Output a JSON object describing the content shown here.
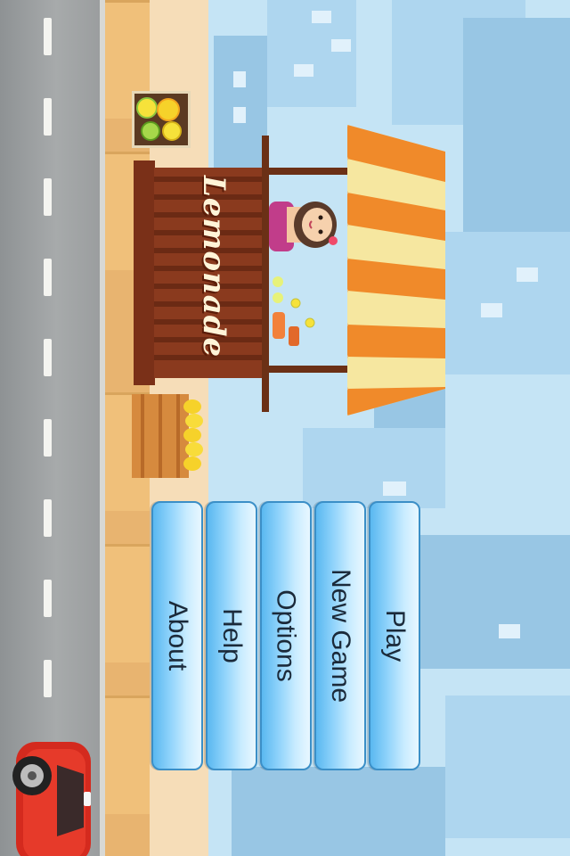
{
  "stall": {
    "sign_text": "Lemonade"
  },
  "menu": {
    "buttons": [
      {
        "id": "play",
        "label": "Play"
      },
      {
        "id": "new-game",
        "label": "New Game"
      },
      {
        "id": "options",
        "label": "Options"
      },
      {
        "id": "help",
        "label": "Help"
      },
      {
        "id": "about",
        "label": "About"
      }
    ]
  },
  "colors": {
    "sky": "#c5e4f5",
    "road": "#a7aaab",
    "sidewalk": "#e8b470",
    "stall_wood": "#8a3a1e",
    "awning_orange": "#f08a2a",
    "awning_cream": "#fff6c4",
    "button_blue": "#8fd3fb",
    "car_red": "#d42a1e"
  }
}
